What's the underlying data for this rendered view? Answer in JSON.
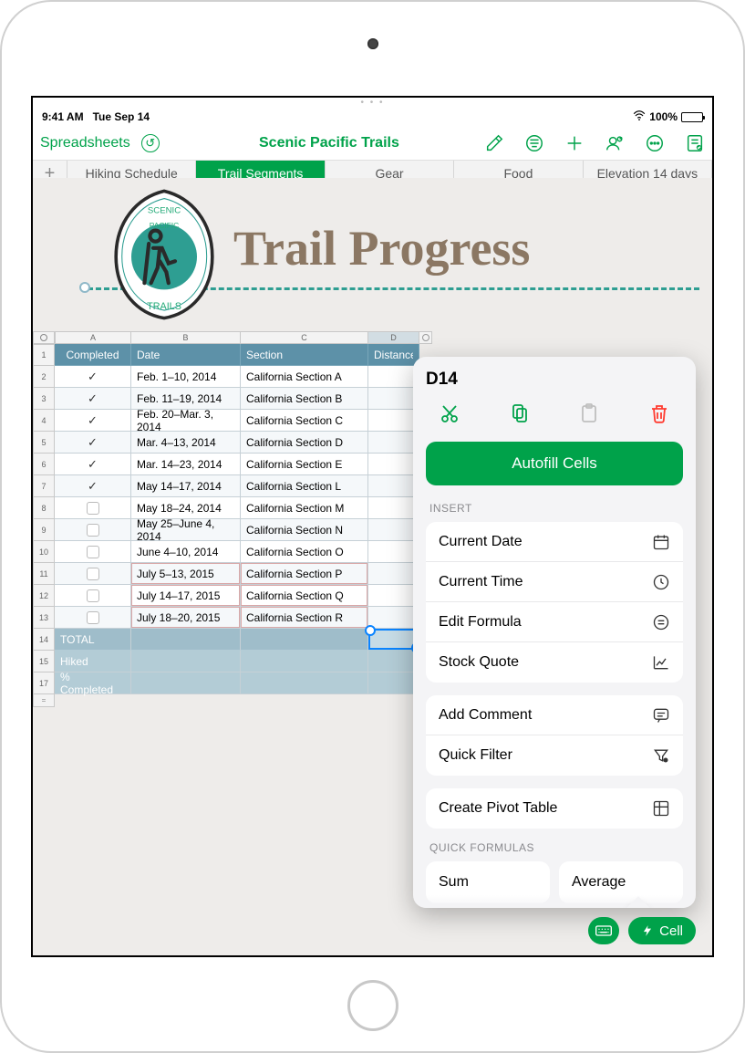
{
  "status": {
    "time": "9:41 AM",
    "date": "Tue Sep 14",
    "battery": "100%"
  },
  "toolbar": {
    "back_label": "Spreadsheets",
    "title": "Scenic Pacific Trails"
  },
  "tabs": [
    "Hiking Schedule",
    "Trail Segments",
    "Gear",
    "Food",
    "Elevation 14 days"
  ],
  "active_tab_index": 1,
  "page_title": "Trail Progress",
  "badge": {
    "top": "SCENIC",
    "mid": "PACIFIC",
    "bottom": "TRAILS"
  },
  "columns": [
    "A",
    "B",
    "C",
    "D"
  ],
  "selected_column_index": 3,
  "headers": {
    "a": "Completed",
    "b": "Date",
    "c": "Section",
    "d": "Distance"
  },
  "rows": [
    {
      "n": "2",
      "done": true,
      "date": "Feb. 1–10, 2014",
      "section": "California Section A"
    },
    {
      "n": "3",
      "done": true,
      "date": "Feb. 11–19, 2014",
      "section": "California Section B"
    },
    {
      "n": "4",
      "done": true,
      "date": "Feb. 20–Mar. 3, 2014",
      "section": "California Section C"
    },
    {
      "n": "5",
      "done": true,
      "date": "Mar. 4–13, 2014",
      "section": "California Section D"
    },
    {
      "n": "6",
      "done": true,
      "date": "Mar. 14–23, 2014",
      "section": "California Section E"
    },
    {
      "n": "7",
      "done": true,
      "date": "May 14–17, 2014",
      "section": "California Section L"
    },
    {
      "n": "8",
      "done": false,
      "date": "May 18–24, 2014",
      "section": "California Section M"
    },
    {
      "n": "9",
      "done": false,
      "date": "May 25–June 4, 2014",
      "section": "California Section N"
    },
    {
      "n": "10",
      "done": false,
      "date": "June 4–10, 2014",
      "section": "California Section O"
    },
    {
      "n": "11",
      "done": false,
      "date": "July 5–13, 2015",
      "section": "California Section P",
      "red": true
    },
    {
      "n": "12",
      "done": false,
      "date": "July 14–17, 2015",
      "section": "California Section Q",
      "red": true
    },
    {
      "n": "13",
      "done": false,
      "date": "July 18–20, 2015",
      "section": "California Section R",
      "red": true
    }
  ],
  "footer_rows": [
    {
      "n": "14",
      "label": "TOTAL",
      "selected": true
    },
    {
      "n": "15",
      "label": "Hiked"
    },
    {
      "n": "17",
      "label": "% Completed"
    }
  ],
  "popover": {
    "cell_ref": "D14",
    "autofill": "Autofill Cells",
    "insert_label": "INSERT",
    "insert_items": [
      "Current Date",
      "Current Time",
      "Edit Formula",
      "Stock Quote"
    ],
    "extra_items": [
      "Add Comment",
      "Quick Filter"
    ],
    "pivot": "Create Pivot Table",
    "formulas_label": "QUICK FORMULAS",
    "formulas": [
      "Sum",
      "Average"
    ]
  },
  "bottom": {
    "cell_label": "Cell"
  }
}
